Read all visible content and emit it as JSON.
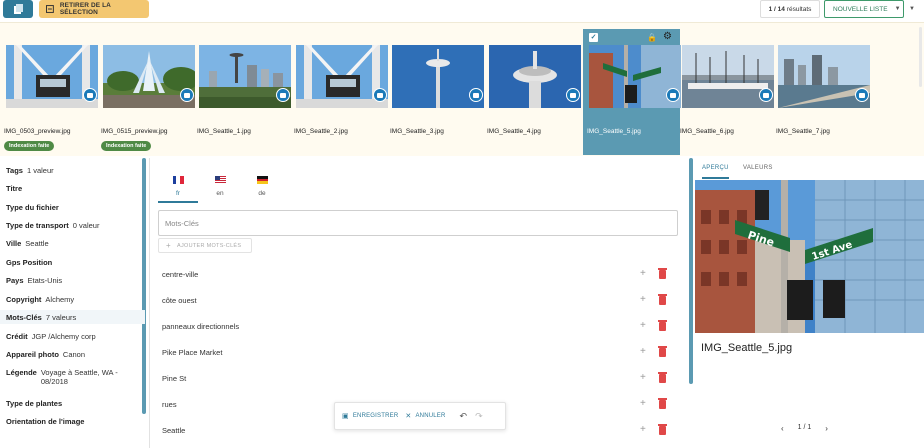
{
  "toolbar": {
    "remove_selection_label": "RETIRER DE LA SÉLECTION",
    "results_count": "1 / 14",
    "results_suffix": "résultats",
    "new_list_label": "NOUVELLE LISTE"
  },
  "thumbnails": [
    {
      "filename": "IMG_0503_preview.jpg",
      "tag": "Indexation faite",
      "scene": "monorail"
    },
    {
      "filename": "IMG_0515_preview.jpg",
      "tag": "Indexation faite",
      "scene": "fountain"
    },
    {
      "filename": "IMG_Seattle_1.jpg",
      "tag": "",
      "scene": "skyline"
    },
    {
      "filename": "IMG_Seattle_2.jpg",
      "tag": "",
      "scene": "monorail"
    },
    {
      "filename": "IMG_Seattle_3.jpg",
      "tag": "",
      "scene": "needle"
    },
    {
      "filename": "IMG_Seattle_4.jpg",
      "tag": "",
      "scene": "needle-top"
    },
    {
      "filename": "IMG_Seattle_5.jpg",
      "tag": "",
      "scene": "street",
      "selected": true
    },
    {
      "filename": "IMG_Seattle_6.jpg",
      "tag": "",
      "scene": "harbor"
    },
    {
      "filename": "IMG_Seattle_7.jpg",
      "tag": "",
      "scene": "waterfront"
    }
  ],
  "metadata": [
    {
      "key": "Tags",
      "value": "1 valeur"
    },
    {
      "key": "Titre",
      "value": ""
    },
    {
      "key": "Type du fichier",
      "value": ""
    },
    {
      "key": "Type de transport",
      "value": "0 valeur"
    },
    {
      "key": "Ville",
      "value": "Seattle"
    },
    {
      "key": "Gps Position",
      "value": ""
    },
    {
      "key": "Pays",
      "value": "Etats-Unis"
    },
    {
      "key": "Copyright",
      "value": "Alchemy"
    },
    {
      "key": "Mots-Clés",
      "value": "7 valeurs",
      "active": true
    },
    {
      "key": "Crédit",
      "value": "JGP /Alchemy corp"
    },
    {
      "key": "Appareil photo",
      "value": "Canon"
    },
    {
      "key": "Légende",
      "value": "Voyage à Seattle, WA - 08/2018"
    },
    {
      "key": "Type de plantes",
      "value": ""
    },
    {
      "key": "Orientation de l'image",
      "value": ""
    }
  ],
  "languages": [
    {
      "code": "fr",
      "active": true
    },
    {
      "code": "en",
      "active": false
    },
    {
      "code": "de",
      "active": false
    }
  ],
  "keywords": {
    "placeholder": "Mots-Clés",
    "add_label": "AJOUTER MOTS-CLÉS",
    "items": [
      "centre-ville",
      "côte ouest",
      "panneaux directionnels",
      "Pike Place Market",
      "Pine St",
      "rues",
      "Seattle"
    ]
  },
  "actions": {
    "save_label": "ENREGISTRER",
    "cancel_label": "ANNULER"
  },
  "preview": {
    "tab_preview": "APERÇU",
    "tab_values": "VALEURS",
    "filename": "IMG_Seattle_5.jpg",
    "pagination": "1 / 1",
    "sign_pine": "Pine",
    "sign_ave": "1st Ave"
  }
}
